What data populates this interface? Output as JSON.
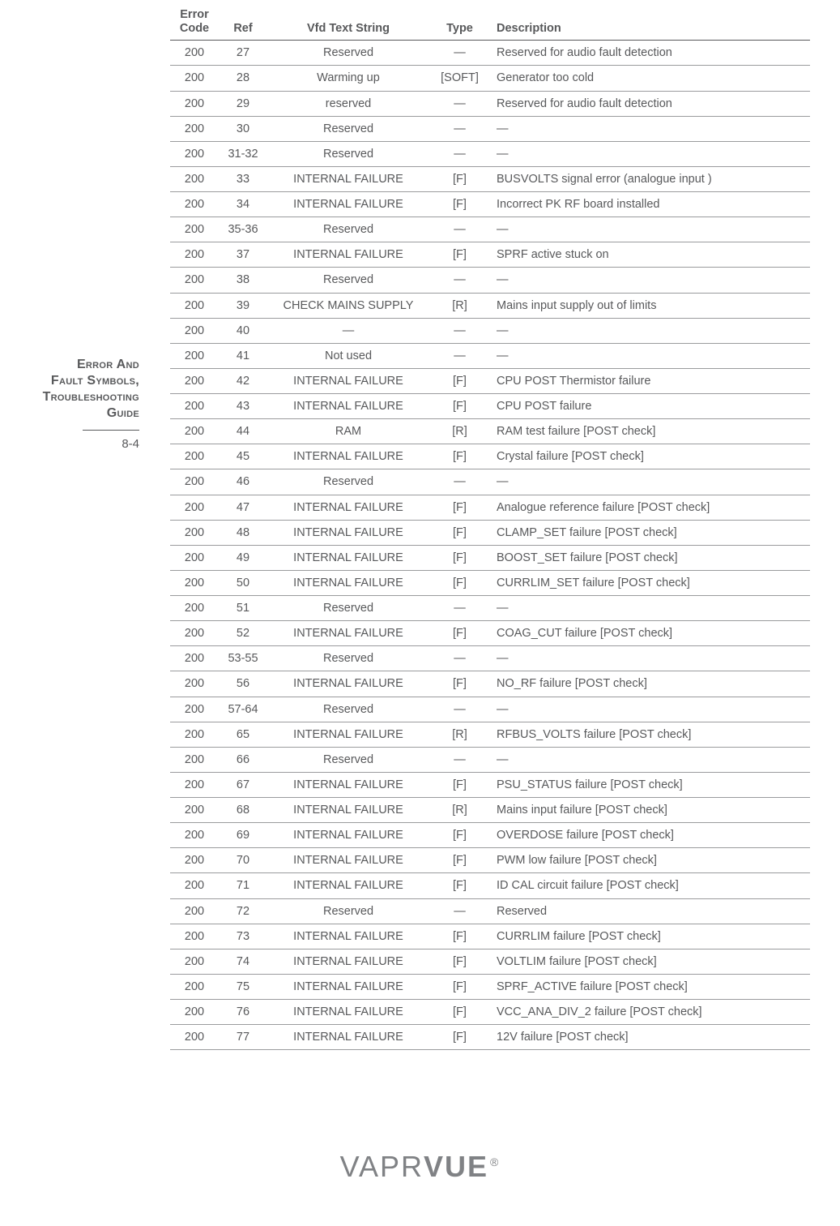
{
  "sidebar": {
    "title_line1": "Error And",
    "title_line2": "Fault Symbols,",
    "title_line3": "Troubleshooting",
    "title_line4": "Guide",
    "page_number": "8-4"
  },
  "table": {
    "headers": {
      "error_code": "Error Code",
      "ref": "Ref",
      "vfd": "Vfd Text String",
      "type": "Type",
      "description": "Description"
    },
    "rows": [
      {
        "code": "200",
        "ref": "27",
        "vfd": "Reserved",
        "type": "—",
        "desc": "Reserved for audio fault detection"
      },
      {
        "code": "200",
        "ref": "28",
        "vfd": "Warming up",
        "type": "[SOFT]",
        "desc": "Generator too cold"
      },
      {
        "code": "200",
        "ref": "29",
        "vfd": "reserved",
        "type": "—",
        "desc": "Reserved for audio fault detection"
      },
      {
        "code": "200",
        "ref": "30",
        "vfd": "Reserved",
        "type": "—",
        "desc": "—"
      },
      {
        "code": "200",
        "ref": "31-32",
        "vfd": "Reserved",
        "type": "—",
        "desc": "—"
      },
      {
        "code": "200",
        "ref": "33",
        "vfd": "INTERNAL FAILURE",
        "type": "[F]",
        "desc": "BUSVOLTS signal error (analogue input )"
      },
      {
        "code": "200",
        "ref": "34",
        "vfd": "INTERNAL FAILURE",
        "type": "[F]",
        "desc": "Incorrect PK RF board installed"
      },
      {
        "code": "200",
        "ref": "35-36",
        "vfd": "Reserved",
        "type": "—",
        "desc": "—"
      },
      {
        "code": "200",
        "ref": "37",
        "vfd": "INTERNAL FAILURE",
        "type": "[F]",
        "desc": "SPRF active stuck on"
      },
      {
        "code": "200",
        "ref": "38",
        "vfd": "Reserved",
        "type": "—",
        "desc": "—"
      },
      {
        "code": "200",
        "ref": "39",
        "vfd": "CHECK MAINS SUPPLY",
        "type": "[R]",
        "desc": "Mains input supply out of limits"
      },
      {
        "code": "200",
        "ref": "40",
        "vfd": "—",
        "type": "—",
        "desc": "—"
      },
      {
        "code": "200",
        "ref": "41",
        "vfd": "Not used",
        "type": "—",
        "desc": "—"
      },
      {
        "code": "200",
        "ref": "42",
        "vfd": "INTERNAL FAILURE",
        "type": "[F]",
        "desc": "CPU POST Thermistor failure"
      },
      {
        "code": "200",
        "ref": "43",
        "vfd": "INTERNAL FAILURE",
        "type": "[F]",
        "desc": "CPU POST failure"
      },
      {
        "code": "200",
        "ref": "44",
        "vfd": "RAM",
        "type": "[R]",
        "desc": "RAM test failure [POST check]"
      },
      {
        "code": "200",
        "ref": "45",
        "vfd": "INTERNAL FAILURE",
        "type": "[F]",
        "desc": "Crystal failure [POST check]"
      },
      {
        "code": "200",
        "ref": "46",
        "vfd": "Reserved",
        "type": "—",
        "desc": "—"
      },
      {
        "code": "200",
        "ref": "47",
        "vfd": "INTERNAL FAILURE",
        "type": "[F]",
        "desc": "Analogue reference failure [POST check]"
      },
      {
        "code": "200",
        "ref": "48",
        "vfd": "INTERNAL FAILURE",
        "type": "[F]",
        "desc": "CLAMP_SET failure [POST check]"
      },
      {
        "code": "200",
        "ref": "49",
        "vfd": "INTERNAL FAILURE",
        "type": "[F]",
        "desc": "BOOST_SET failure [POST check]"
      },
      {
        "code": "200",
        "ref": "50",
        "vfd": "INTERNAL FAILURE",
        "type": "[F]",
        "desc": "CURRLIM_SET failure [POST check]"
      },
      {
        "code": "200",
        "ref": "51",
        "vfd": "Reserved",
        "type": "—",
        "desc": "—"
      },
      {
        "code": "200",
        "ref": "52",
        "vfd": "INTERNAL FAILURE",
        "type": "[F]",
        "desc": "COAG_CUT failure [POST check]"
      },
      {
        "code": "200",
        "ref": "53-55",
        "vfd": "Reserved",
        "type": "—",
        "desc": "—"
      },
      {
        "code": "200",
        "ref": "56",
        "vfd": "INTERNAL FAILURE",
        "type": "[F]",
        "desc": "NO_RF failure [POST check]"
      },
      {
        "code": "200",
        "ref": "57-64",
        "vfd": "Reserved",
        "type": "—",
        "desc": "—"
      },
      {
        "code": "200",
        "ref": "65",
        "vfd": "INTERNAL FAILURE",
        "type": "[R]",
        "desc": "RFBUS_VOLTS failure [POST check]"
      },
      {
        "code": "200",
        "ref": "66",
        "vfd": "Reserved",
        "type": "—",
        "desc": "—"
      },
      {
        "code": "200",
        "ref": "67",
        "vfd": "INTERNAL FAILURE",
        "type": "[F]",
        "desc": "PSU_STATUS failure [POST check]"
      },
      {
        "code": "200",
        "ref": "68",
        "vfd": "INTERNAL FAILURE",
        "type": "[R]",
        "desc": "Mains input failure [POST check]"
      },
      {
        "code": "200",
        "ref": "69",
        "vfd": "INTERNAL FAILURE",
        "type": "[F]",
        "desc": "OVERDOSE failure [POST check]"
      },
      {
        "code": "200",
        "ref": "70",
        "vfd": "INTERNAL FAILURE",
        "type": "[F]",
        "desc": "PWM low failure [POST check]"
      },
      {
        "code": "200",
        "ref": "71",
        "vfd": "INTERNAL FAILURE",
        "type": "[F]",
        "desc": "ID CAL circuit failure [POST check]"
      },
      {
        "code": "200",
        "ref": "72",
        "vfd": "Reserved",
        "type": "—",
        "desc": "Reserved"
      },
      {
        "code": "200",
        "ref": "73",
        "vfd": "INTERNAL FAILURE",
        "type": "[F]",
        "desc": "CURRLIM failure [POST check]"
      },
      {
        "code": "200",
        "ref": "74",
        "vfd": "INTERNAL FAILURE",
        "type": "[F]",
        "desc": "VOLTLIM failure [POST check]"
      },
      {
        "code": "200",
        "ref": "75",
        "vfd": "INTERNAL FAILURE",
        "type": "[F]",
        "desc": "SPRF_ACTIVE  failure [POST check]"
      },
      {
        "code": "200",
        "ref": "76",
        "vfd": "INTERNAL FAILURE",
        "type": "[F]",
        "desc": "VCC_ANA_DIV_2 failure [POST check]"
      },
      {
        "code": "200",
        "ref": "77",
        "vfd": "INTERNAL FAILURE",
        "type": "[F]",
        "desc": "12V failure [POST check]"
      }
    ]
  },
  "logo": {
    "part1": "VAPR",
    "part2": "VUE",
    "reg": "®"
  }
}
